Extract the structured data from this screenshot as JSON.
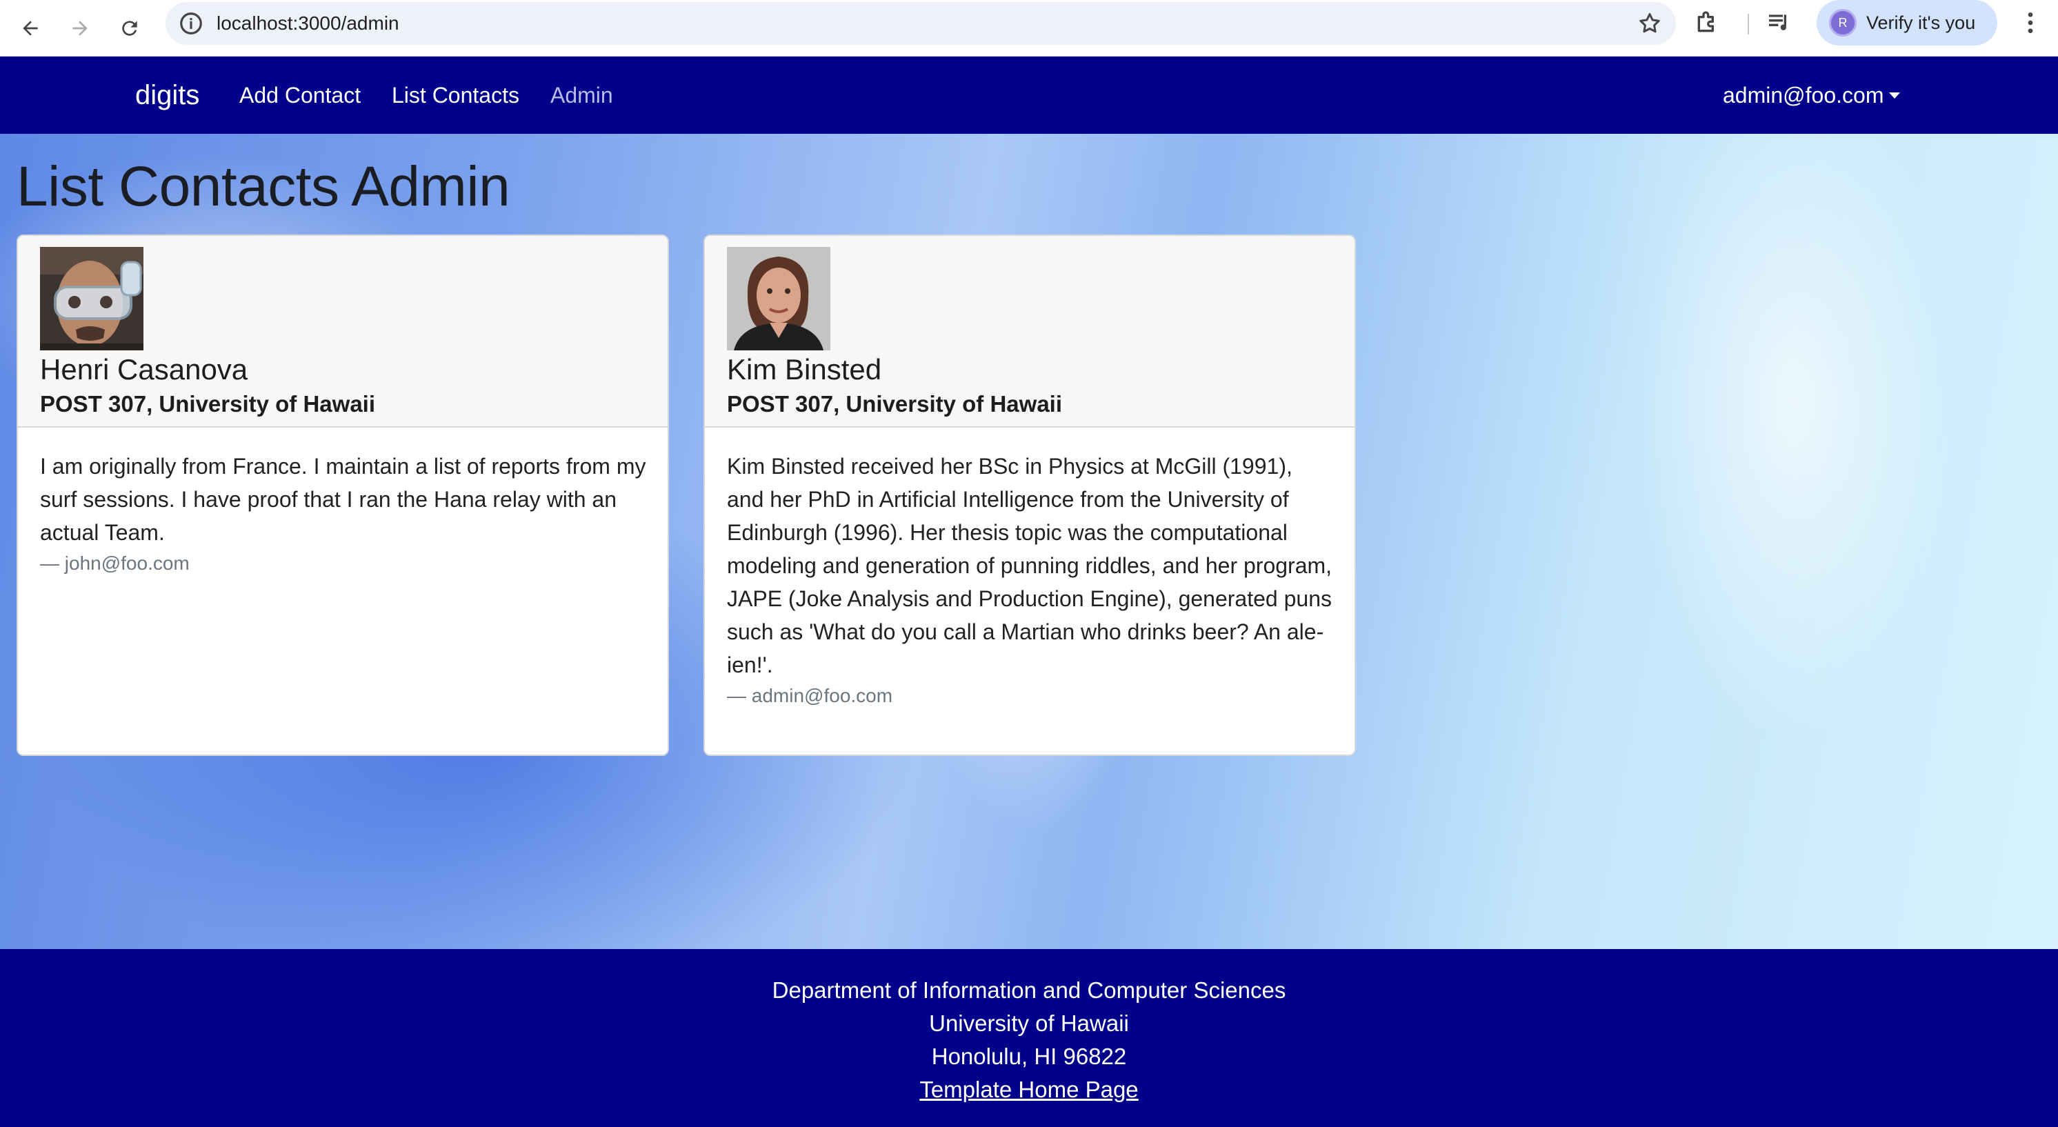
{
  "browser": {
    "url": "localhost:3000/admin",
    "profile_button": "Verify it's you",
    "profile_initial": "R"
  },
  "navbar": {
    "brand": "digits",
    "links": [
      "Add Contact",
      "List Contacts",
      "Admin"
    ],
    "user": "admin@foo.com"
  },
  "page": {
    "title": "List Contacts Admin"
  },
  "contacts": [
    {
      "name": "Henri Casanova",
      "address": "POST 307, University of Hawaii",
      "description": "I am originally from France. I maintain a list of reports from my surf sessions. I have proof that I ran the Hana relay with an actual Team.",
      "owner": "— john@foo.com"
    },
    {
      "name": "Kim Binsted",
      "address": "POST 307, University of Hawaii",
      "description": "Kim Binsted received her BSc in Physics at McGill (1991), and her PhD in Artificial Intelligence from the University of Edinburgh (1996). Her thesis topic was the computational modeling and generation of punning riddles, and her program, JAPE (Joke Analysis and Production Engine), generated puns such as 'What do you call a Martian who drinks beer? An ale-ien!'.",
      "owner": "— admin@foo.com"
    }
  ],
  "footer": {
    "line1": "Department of Information and Computer Sciences",
    "line2": "University of Hawaii",
    "line3": "Honolulu, HI 96822",
    "link": "Template Home Page"
  },
  "colors": {
    "navbar": "#00008b",
    "footer": "#00008b"
  }
}
